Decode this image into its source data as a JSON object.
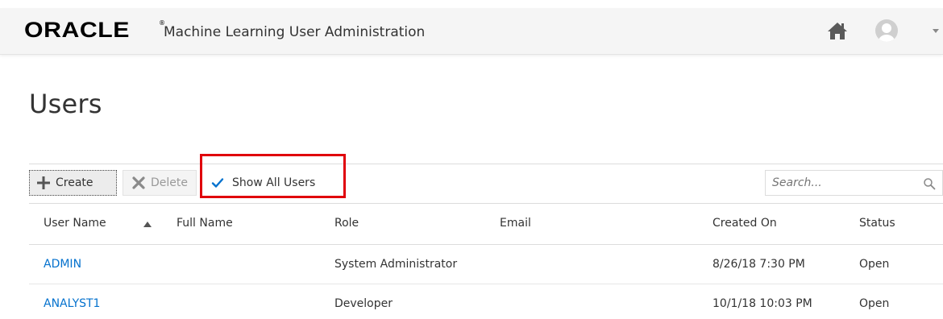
{
  "header": {
    "logo_text": "ORACLE",
    "logo_mark": "®",
    "app_title": "Machine Learning User Administration",
    "home_icon": "home-icon",
    "user_icon": "user-avatar-icon",
    "menu_icon": "caret-down-icon"
  },
  "page": {
    "title": "Users"
  },
  "toolbar": {
    "create_label": "Create",
    "create_icon": "plus-icon",
    "delete_label": "Delete",
    "delete_icon": "x-icon",
    "show_all_label": "Show All Users",
    "show_all_checked": true,
    "search_placeholder": "Search...",
    "search_value": "",
    "highlight_color": "#e0000b"
  },
  "table": {
    "columns": {
      "user_name": "User Name",
      "full_name": "Full Name",
      "role": "Role",
      "email": "Email",
      "created_on": "Created On",
      "status": "Status"
    },
    "sort": {
      "column": "User Name",
      "direction": "ascending"
    },
    "rows": [
      {
        "user_name": "ADMIN",
        "full_name": "",
        "role": "System Administrator",
        "email": "",
        "created_on": "8/26/18 7:30 PM",
        "status": "Open"
      },
      {
        "user_name": "ANALYST1",
        "full_name": "",
        "role": "Developer",
        "email": "",
        "created_on": "10/1/18 10:03 PM",
        "status": "Open"
      }
    ]
  },
  "colors": {
    "link": "#0572ce",
    "header_bg": "#f5f5f5",
    "checkbox_check": "#0572ce"
  }
}
